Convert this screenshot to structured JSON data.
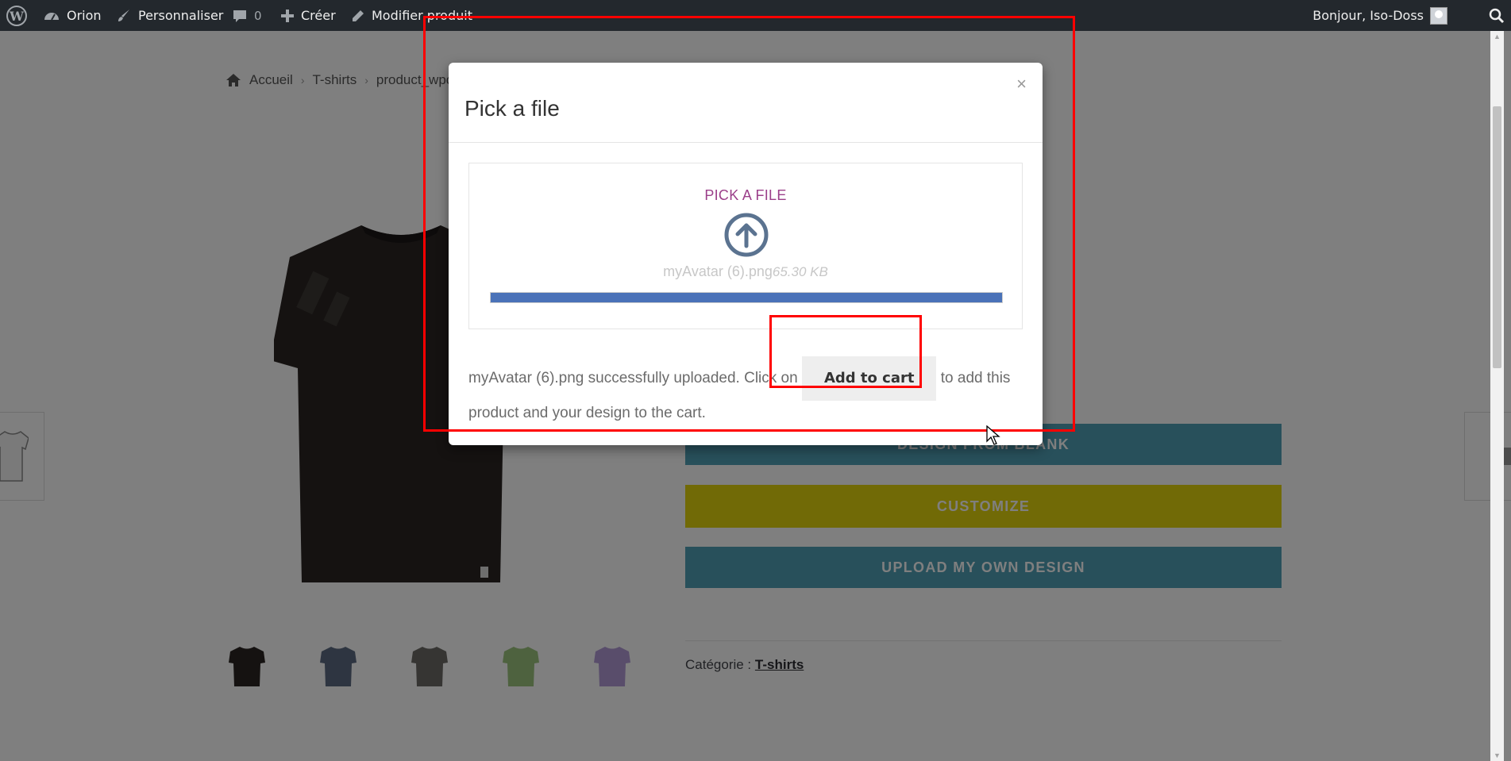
{
  "admin_bar": {
    "site_name": "Orion",
    "customize": "Personnaliser",
    "comments_count": "0",
    "new": "Créer",
    "edit_product": "Modifier produit",
    "greeting": "Bonjour, Iso-Doss"
  },
  "breadcrumb": {
    "home": "Accueil",
    "category": "T-shirts",
    "current": "product_wpc"
  },
  "product": {
    "buttons": {
      "design_blank": "DESIGN FROM BLANK",
      "customize": "CUSTOMIZE",
      "upload": "UPLOAD MY OWN DESIGN"
    },
    "category_label": "Catégorie :",
    "category_value": "T-shirts",
    "thumbnail_colors": [
      "#2a2422",
      "#5d6b82",
      "#6c6a66",
      "#9cc57e",
      "#b29ad6"
    ],
    "main_color": "#2a2422"
  },
  "modal": {
    "title": "Pick a file",
    "close": "×",
    "pick_label": "PICK A FILE",
    "file_name": "myAvatar (6).png",
    "file_size": "65.30 KB",
    "progress": 1.0,
    "message_before": "myAvatar (6).png successfully uploaded. Click on",
    "add_to_cart": "Add to cart",
    "message_after": "to add this product and your design to the cart."
  },
  "colors": {
    "admin_bar": "#23282d",
    "accent_teal": "#51a0b7",
    "accent_yellow": "#e3d40d",
    "pick_purple": "#9b3f8a",
    "progress": "#4a72b8"
  }
}
